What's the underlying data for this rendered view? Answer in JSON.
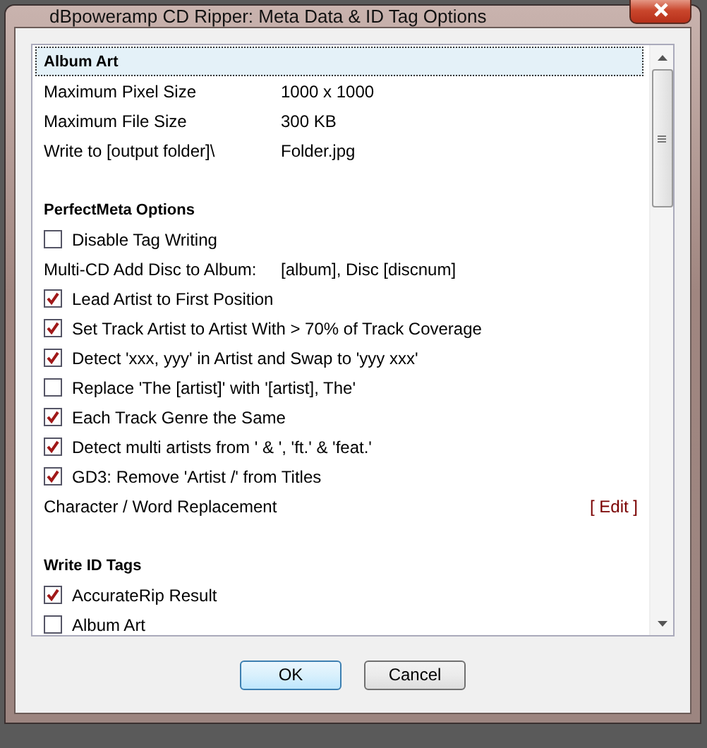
{
  "window": {
    "title": "dBpoweramp CD Ripper: Meta Data & ID Tag Options"
  },
  "sections": [
    {
      "title": "Album Art",
      "selected": true,
      "items": [
        {
          "kind": "value",
          "label": "Maximum Pixel Size",
          "value": "1000 x 1000"
        },
        {
          "kind": "value",
          "label": "Maximum File Size",
          "value": "300 KB"
        },
        {
          "kind": "value",
          "label": "Write to [output folder]\\",
          "value": "Folder.jpg"
        }
      ]
    },
    {
      "title": "PerfectMeta Options",
      "selected": false,
      "items": [
        {
          "kind": "check",
          "label": "Disable Tag Writing",
          "checked": false
        },
        {
          "kind": "value",
          "label": "Multi-CD Add Disc to Album:",
          "value": "[album], Disc [discnum]"
        },
        {
          "kind": "check",
          "label": "Lead Artist to First Position",
          "checked": true
        },
        {
          "kind": "check",
          "label": "Set Track Artist to Artist With > 70% of Track Coverage",
          "checked": true
        },
        {
          "kind": "check",
          "label": "Detect 'xxx, yyy' in Artist and Swap to 'yyy xxx'",
          "checked": true
        },
        {
          "kind": "check",
          "label": "Replace 'The [artist]' with '[artist], The'",
          "checked": false
        },
        {
          "kind": "check",
          "label": "Each Track Genre the Same",
          "checked": true
        },
        {
          "kind": "check",
          "label": "Detect multi artists from ' & ', 'ft.' & 'feat.'",
          "checked": true
        },
        {
          "kind": "check",
          "label": "GD3: Remove 'Artist /' from Titles",
          "checked": true
        },
        {
          "kind": "link",
          "label": "Character / Word Replacement",
          "action": "[ Edit ]"
        }
      ]
    },
    {
      "title": "Write ID Tags",
      "selected": false,
      "items": [
        {
          "kind": "check",
          "label": "AccurateRip Result",
          "checked": true
        },
        {
          "kind": "check",
          "label": "Album Art",
          "checked": false
        }
      ]
    }
  ],
  "buttons": [
    {
      "label": "OK",
      "selected": true
    },
    {
      "label": "Cancel",
      "selected": false
    }
  ]
}
